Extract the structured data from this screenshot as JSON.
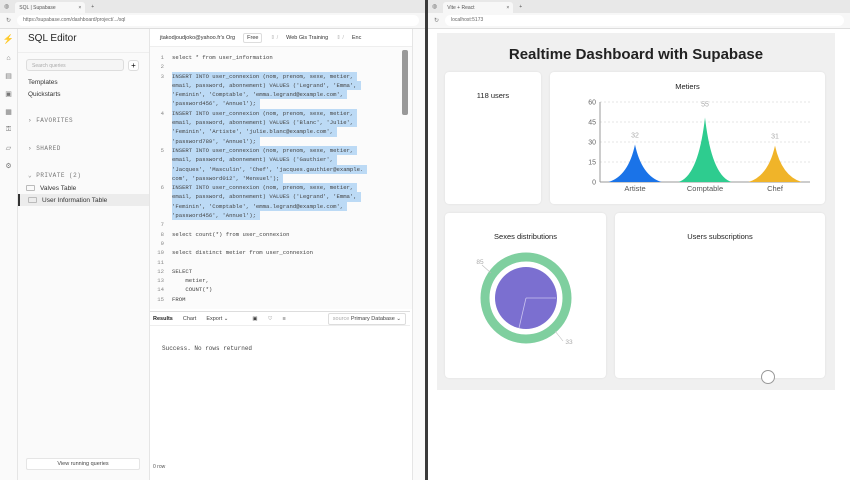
{
  "left_window": {
    "tab_title": "SQL | Supabase",
    "url": "https://supabase.com/dashboard/project/.../sql",
    "sidebar": {
      "title": "SQL Editor",
      "search_placeholder": "Search queries",
      "plus": "+",
      "links": [
        "Templates",
        "Quickstarts"
      ],
      "sections": {
        "favorites": "FAVORITES",
        "shared": "SHARED",
        "private": "PRIVATE (2)"
      },
      "items": [
        {
          "label": "Valves Table",
          "active": false
        },
        {
          "label": "User Information Table",
          "active": true
        }
      ],
      "view_running": "View running queries"
    },
    "topbar": {
      "org": "jtakodjoudjoko@yahoo.fr's Org",
      "plan": "Free",
      "project": "Web Gis Training",
      "env": "Enc"
    },
    "code": [
      {
        "n": "1",
        "t": "select * from user_information",
        "hl": false
      },
      {
        "n": "2",
        "t": "",
        "hl": false
      },
      {
        "n": "3",
        "t": "INSERT INTO user_connexion (nom, prenom, sexe, metier,",
        "hl": true
      },
      {
        "n": "",
        "t": "email, password, abonnement) VALUES ('Legrand', 'Emma',",
        "hl": true
      },
      {
        "n": "",
        "t": "'Feminin', 'Comptable', 'emma.legrand@example.com',",
        "hl": true
      },
      {
        "n": "",
        "t": "'password456', 'Annuel');",
        "hl": true
      },
      {
        "n": "4",
        "t": "INSERT INTO user_connexion (nom, prenom, sexe, metier,",
        "hl": true
      },
      {
        "n": "",
        "t": "email, password, abonnement) VALUES ('Blanc', 'Julie',",
        "hl": true
      },
      {
        "n": "",
        "t": "'Feminin', 'Artiste', 'julie.blanc@example.com',",
        "hl": true
      },
      {
        "n": "",
        "t": "'password789', 'Annuel');",
        "hl": true
      },
      {
        "n": "5",
        "t": "INSERT INTO user_connexion (nom, prenom, sexe, metier,",
        "hl": true
      },
      {
        "n": "",
        "t": "email, password, abonnement) VALUES ('Gauthier',",
        "hl": true
      },
      {
        "n": "",
        "t": "'Jacques', 'Masculin', 'Chef', 'jacques.gauthier@example.",
        "hl": true
      },
      {
        "n": "",
        "t": "com', 'password012', 'Mensuel');",
        "hl": true
      },
      {
        "n": "6",
        "t": "INSERT INTO user_connexion (nom, prenom, sexe, metier,",
        "hl": true
      },
      {
        "n": "",
        "t": "email, password, abonnement) VALUES ('Legrand', 'Emma',",
        "hl": true
      },
      {
        "n": "",
        "t": "'Feminin', 'Comptable', 'emma.legrand@example.com',",
        "hl": true
      },
      {
        "n": "",
        "t": "'password456', 'Annuel');",
        "hl": true
      },
      {
        "n": "7",
        "t": "",
        "hl": false
      },
      {
        "n": "8",
        "t": "select count(*) from user_connexion",
        "hl": false
      },
      {
        "n": "9",
        "t": "",
        "hl": false
      },
      {
        "n": "10",
        "t": "select distinct metier from user_connexion",
        "hl": false
      },
      {
        "n": "11",
        "t": "",
        "hl": false
      },
      {
        "n": "12",
        "t": "SELECT",
        "hl": false
      },
      {
        "n": "13",
        "t": "    metier,",
        "hl": false
      },
      {
        "n": "14",
        "t": "    COUNT(*)",
        "hl": false
      },
      {
        "n": "15",
        "t": "FROM",
        "hl": false
      }
    ],
    "results": {
      "tabs": [
        "Results",
        "Chart",
        "Export"
      ],
      "source_label": "source",
      "source": "Primary Database",
      "message": "Success. No rows returned",
      "row_count": "0 row"
    }
  },
  "right_window": {
    "tab_title": "Vite + React",
    "url": "localhost:5173",
    "dashboard": {
      "title": "Realtime Dashboard with Supabase",
      "users": "118 users",
      "sexes_title": "Sexes distributions",
      "subs_title": "Users subscriptions"
    }
  },
  "chart_data": [
    {
      "type": "bar",
      "title": "Metiers",
      "categories": [
        "Artiste",
        "Comptable",
        "Chef"
      ],
      "values": [
        32,
        55,
        31
      ],
      "colors": [
        "#1a73e8",
        "#2ecc8f",
        "#f0b429"
      ],
      "ylim": [
        0,
        60
      ],
      "yticks": [
        0,
        15,
        30,
        45,
        60
      ]
    },
    {
      "type": "pie",
      "title": "Sexes distributions",
      "values": [
        85,
        33
      ],
      "colors": [
        "#7b6fd0",
        "#7fcf9f"
      ]
    }
  ]
}
